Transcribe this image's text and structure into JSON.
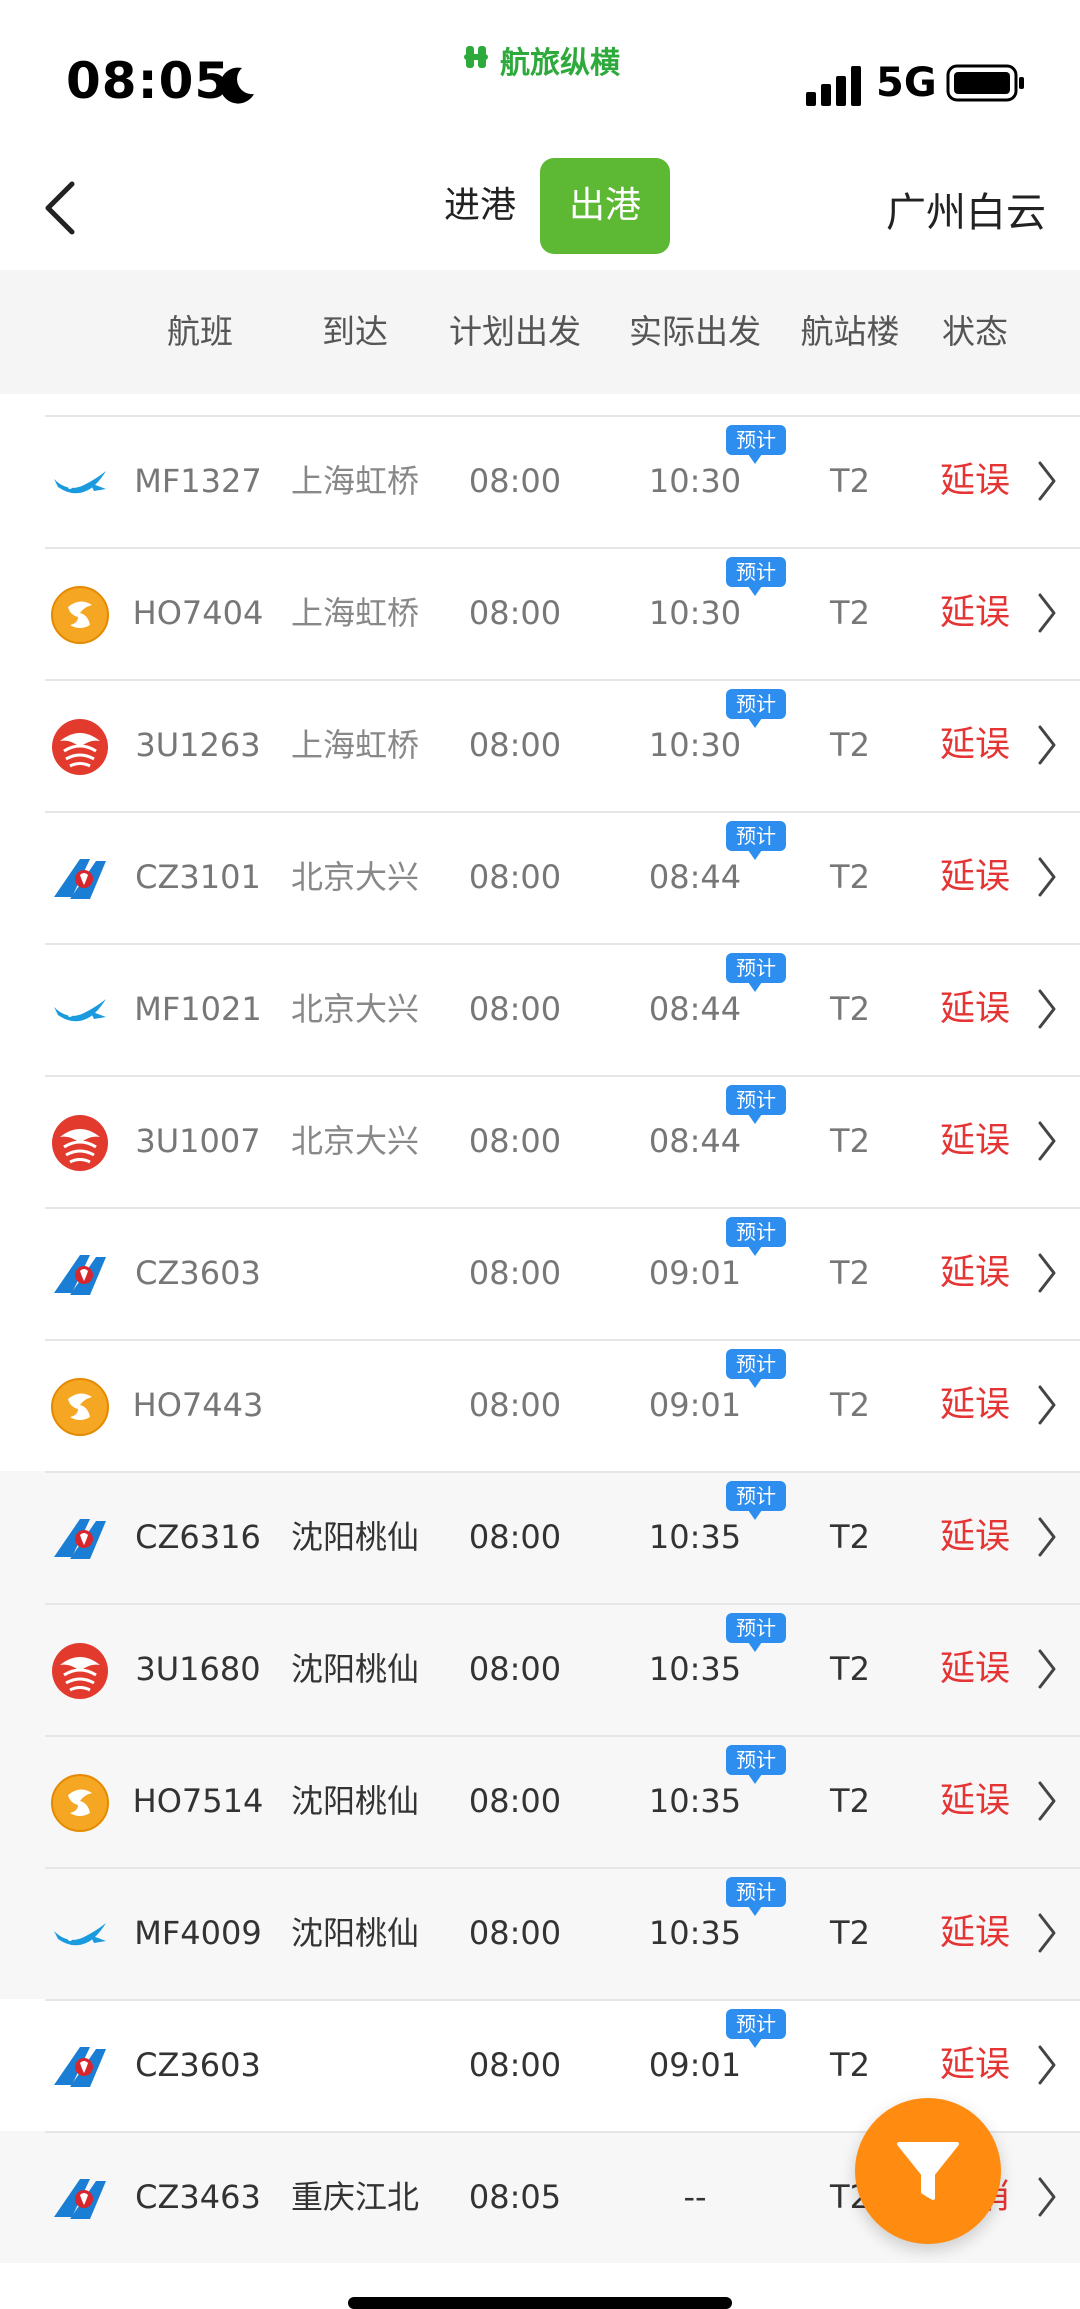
{
  "status_bar": {
    "time": "08:05",
    "network": "5G",
    "brand": "航旅纵横"
  },
  "nav": {
    "tab_arrivals": "进港",
    "tab_departures": "出港",
    "airport": "广州白云"
  },
  "table_header": {
    "flight": "航班",
    "destination": "到达",
    "scheduled": "计划出发",
    "actual": "实际出发",
    "terminal": "航站楼",
    "status": "状态"
  },
  "badge_label": "预计",
  "rows": [
    {
      "airline": "xiamen",
      "flight": "MF1327",
      "dest": "上海虹桥",
      "sched": "08:00",
      "actual": "10:30",
      "term": "T2",
      "status": "延误",
      "shade": false,
      "dark": false,
      "badge": true
    },
    {
      "airline": "hainan",
      "flight": "HO7404",
      "dest": "上海虹桥",
      "sched": "08:00",
      "actual": "10:30",
      "term": "T2",
      "status": "延误",
      "shade": false,
      "dark": false,
      "badge": true
    },
    {
      "airline": "sichuan",
      "flight": "3U1263",
      "dest": "上海虹桥",
      "sched": "08:00",
      "actual": "10:30",
      "term": "T2",
      "status": "延误",
      "shade": false,
      "dark": false,
      "badge": true
    },
    {
      "airline": "southern",
      "flight": "CZ3101",
      "dest": "北京大兴",
      "sched": "08:00",
      "actual": "08:44",
      "term": "T2",
      "status": "延误",
      "shade": false,
      "dark": false,
      "badge": true
    },
    {
      "airline": "xiamen",
      "flight": "MF1021",
      "dest": "北京大兴",
      "sched": "08:00",
      "actual": "08:44",
      "term": "T2",
      "status": "延误",
      "shade": false,
      "dark": false,
      "badge": true
    },
    {
      "airline": "sichuan",
      "flight": "3U1007",
      "dest": "北京大兴",
      "sched": "08:00",
      "actual": "08:44",
      "term": "T2",
      "status": "延误",
      "shade": false,
      "dark": false,
      "badge": true
    },
    {
      "airline": "southern",
      "flight": "CZ3603",
      "dest": "",
      "sched": "08:00",
      "actual": "09:01",
      "term": "T2",
      "status": "延误",
      "shade": false,
      "dark": false,
      "badge": true
    },
    {
      "airline": "hainan",
      "flight": "HO7443",
      "dest": "",
      "sched": "08:00",
      "actual": "09:01",
      "term": "T2",
      "status": "延误",
      "shade": false,
      "dark": false,
      "badge": true
    },
    {
      "airline": "southern",
      "flight": "CZ6316",
      "dest": "沈阳桃仙",
      "sched": "08:00",
      "actual": "10:35",
      "term": "T2",
      "status": "延误",
      "shade": true,
      "dark": true,
      "badge": true
    },
    {
      "airline": "sichuan",
      "flight": "3U1680",
      "dest": "沈阳桃仙",
      "sched": "08:00",
      "actual": "10:35",
      "term": "T2",
      "status": "延误",
      "shade": true,
      "dark": true,
      "badge": true
    },
    {
      "airline": "hainan",
      "flight": "HO7514",
      "dest": "沈阳桃仙",
      "sched": "08:00",
      "actual": "10:35",
      "term": "T2",
      "status": "延误",
      "shade": true,
      "dark": true,
      "badge": true
    },
    {
      "airline": "xiamen",
      "flight": "MF4009",
      "dest": "沈阳桃仙",
      "sched": "08:00",
      "actual": "10:35",
      "term": "T2",
      "status": "延误",
      "shade": true,
      "dark": true,
      "badge": true
    },
    {
      "airline": "southern",
      "flight": "CZ3603",
      "dest": "",
      "sched": "08:00",
      "actual": "09:01",
      "term": "T2",
      "status": "延误",
      "shade": false,
      "dark": true,
      "badge": true
    },
    {
      "airline": "southern",
      "flight": "CZ3463",
      "dest": "重庆江北",
      "sched": "08:05",
      "actual": "--",
      "term": "T2",
      "status": "取消",
      "shade": true,
      "dark": true,
      "badge": false
    }
  ],
  "colors": {
    "accent_green": "#5db834",
    "delay_red": "#e53434",
    "badge_blue": "#2d8ef0",
    "filter_orange": "#ff8c11"
  },
  "icons": {
    "back": "chevron-left-icon",
    "row_arrow": "chevron-right-icon",
    "filter": "filter-funnel-icon"
  }
}
